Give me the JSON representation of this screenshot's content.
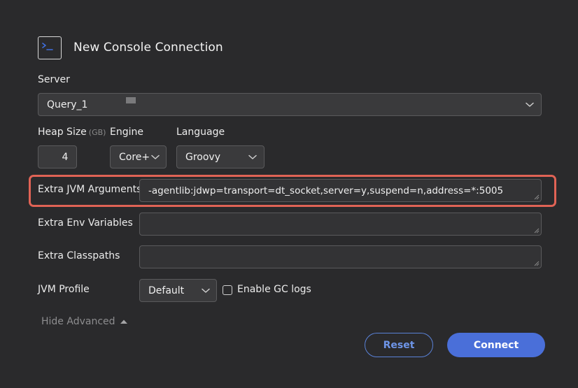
{
  "header": {
    "icon": "terminal-icon",
    "title": "New Console Connection"
  },
  "server": {
    "label": "Server",
    "value": "Query_1"
  },
  "heap": {
    "label": "Heap Size",
    "unit": "(GB)",
    "value": "4"
  },
  "engine": {
    "label": "Engine",
    "value": "Core+"
  },
  "language": {
    "label": "Language",
    "value": "Groovy"
  },
  "extra_jvm": {
    "label": "Extra JVM Arguments",
    "value": "-agentlib:jdwp=transport=dt_socket,server=y,suspend=n,address=*:5005",
    "highlight_color": "#e06355"
  },
  "extra_env": {
    "label": "Extra Env Variables",
    "value": ""
  },
  "extra_classpaths": {
    "label": "Extra Classpaths",
    "value": ""
  },
  "jvm_profile": {
    "label": "JVM Profile",
    "value": "Default"
  },
  "gc_logs": {
    "label": "Enable GC logs",
    "checked": false
  },
  "advanced": {
    "label": "Hide Advanced"
  },
  "actions": {
    "reset_label": "Reset",
    "connect_label": "Connect",
    "accent": "#4a6fd9"
  }
}
